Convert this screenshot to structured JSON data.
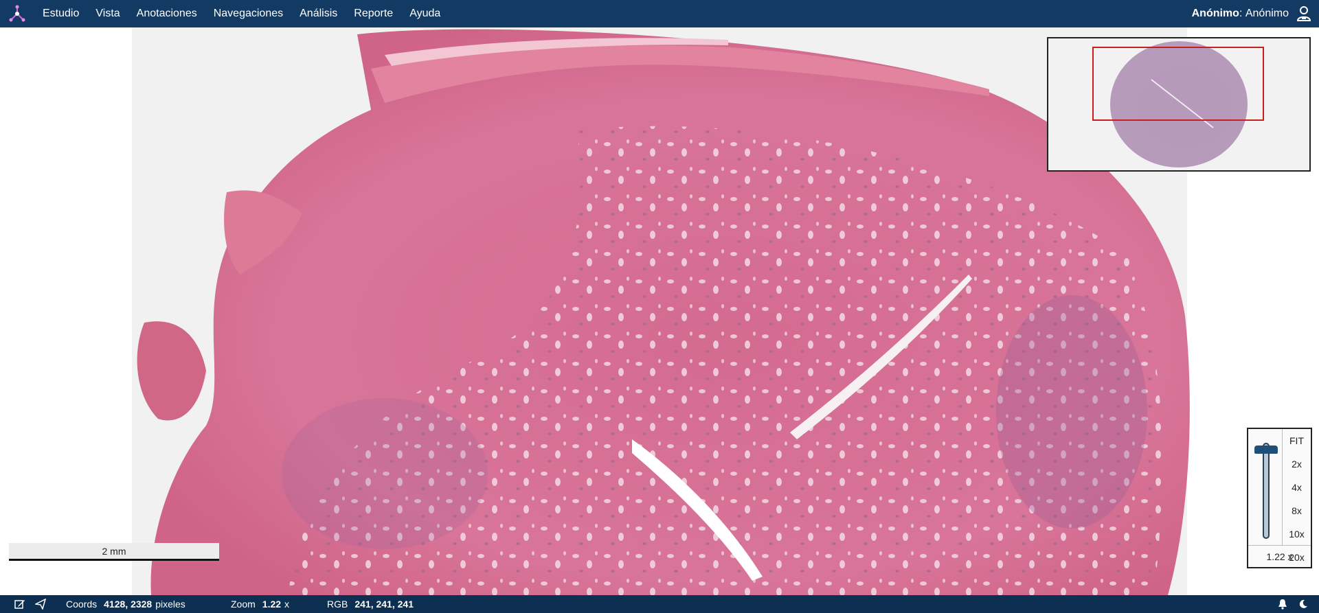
{
  "app": {
    "menu": [
      "Estudio",
      "Vista",
      "Anotaciones",
      "Navegaciones",
      "Análisis",
      "Reporte",
      "Ayuda"
    ],
    "user_role": "Anónimo",
    "user_sep": ":",
    "user_name": "Anónimo"
  },
  "viewer": {
    "scale_label": "2 mm",
    "zoom_levels": [
      "FIT",
      "2x",
      "4x",
      "8x",
      "10x",
      "20x"
    ],
    "zoom_current": "1.22 x"
  },
  "status": {
    "coords_label": "Coords",
    "coords_value": "4128, 2328",
    "coords_unit": "pixeles",
    "zoom_label": "Zoom",
    "zoom_value": "1.22",
    "zoom_unit": "x",
    "rgb_label": "RGB",
    "rgb_value": "241, 241, 241"
  },
  "colors": {
    "topbar": "#133a63",
    "statusbar": "#0d2f52",
    "tissue": "#d9708f",
    "minimap_viewport": "#c81e1e"
  },
  "icons": {
    "logo": "network-logo",
    "user": "user-icon",
    "edit": "edit-icon",
    "send": "send-icon",
    "bell": "bell-icon",
    "moon": "moon-icon"
  }
}
